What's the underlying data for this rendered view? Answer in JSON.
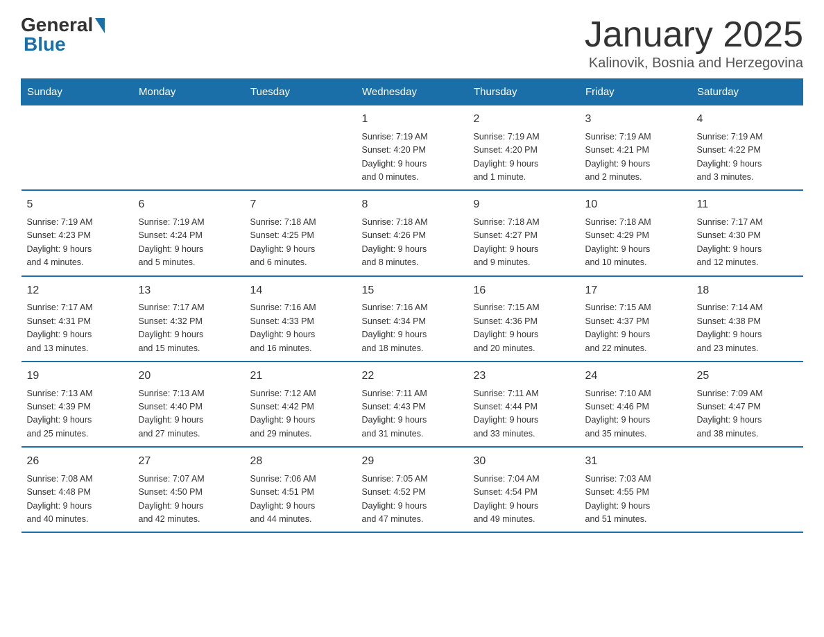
{
  "logo": {
    "general": "General",
    "blue": "Blue"
  },
  "header": {
    "month_title": "January 2025",
    "location": "Kalinovik, Bosnia and Herzegovina"
  },
  "days_of_week": [
    "Sunday",
    "Monday",
    "Tuesday",
    "Wednesday",
    "Thursday",
    "Friday",
    "Saturday"
  ],
  "weeks": [
    [
      {
        "day": "",
        "info": ""
      },
      {
        "day": "",
        "info": ""
      },
      {
        "day": "",
        "info": ""
      },
      {
        "day": "1",
        "info": "Sunrise: 7:19 AM\nSunset: 4:20 PM\nDaylight: 9 hours\nand 0 minutes."
      },
      {
        "day": "2",
        "info": "Sunrise: 7:19 AM\nSunset: 4:20 PM\nDaylight: 9 hours\nand 1 minute."
      },
      {
        "day": "3",
        "info": "Sunrise: 7:19 AM\nSunset: 4:21 PM\nDaylight: 9 hours\nand 2 minutes."
      },
      {
        "day": "4",
        "info": "Sunrise: 7:19 AM\nSunset: 4:22 PM\nDaylight: 9 hours\nand 3 minutes."
      }
    ],
    [
      {
        "day": "5",
        "info": "Sunrise: 7:19 AM\nSunset: 4:23 PM\nDaylight: 9 hours\nand 4 minutes."
      },
      {
        "day": "6",
        "info": "Sunrise: 7:19 AM\nSunset: 4:24 PM\nDaylight: 9 hours\nand 5 minutes."
      },
      {
        "day": "7",
        "info": "Sunrise: 7:18 AM\nSunset: 4:25 PM\nDaylight: 9 hours\nand 6 minutes."
      },
      {
        "day": "8",
        "info": "Sunrise: 7:18 AM\nSunset: 4:26 PM\nDaylight: 9 hours\nand 8 minutes."
      },
      {
        "day": "9",
        "info": "Sunrise: 7:18 AM\nSunset: 4:27 PM\nDaylight: 9 hours\nand 9 minutes."
      },
      {
        "day": "10",
        "info": "Sunrise: 7:18 AM\nSunset: 4:29 PM\nDaylight: 9 hours\nand 10 minutes."
      },
      {
        "day": "11",
        "info": "Sunrise: 7:17 AM\nSunset: 4:30 PM\nDaylight: 9 hours\nand 12 minutes."
      }
    ],
    [
      {
        "day": "12",
        "info": "Sunrise: 7:17 AM\nSunset: 4:31 PM\nDaylight: 9 hours\nand 13 minutes."
      },
      {
        "day": "13",
        "info": "Sunrise: 7:17 AM\nSunset: 4:32 PM\nDaylight: 9 hours\nand 15 minutes."
      },
      {
        "day": "14",
        "info": "Sunrise: 7:16 AM\nSunset: 4:33 PM\nDaylight: 9 hours\nand 16 minutes."
      },
      {
        "day": "15",
        "info": "Sunrise: 7:16 AM\nSunset: 4:34 PM\nDaylight: 9 hours\nand 18 minutes."
      },
      {
        "day": "16",
        "info": "Sunrise: 7:15 AM\nSunset: 4:36 PM\nDaylight: 9 hours\nand 20 minutes."
      },
      {
        "day": "17",
        "info": "Sunrise: 7:15 AM\nSunset: 4:37 PM\nDaylight: 9 hours\nand 22 minutes."
      },
      {
        "day": "18",
        "info": "Sunrise: 7:14 AM\nSunset: 4:38 PM\nDaylight: 9 hours\nand 23 minutes."
      }
    ],
    [
      {
        "day": "19",
        "info": "Sunrise: 7:13 AM\nSunset: 4:39 PM\nDaylight: 9 hours\nand 25 minutes."
      },
      {
        "day": "20",
        "info": "Sunrise: 7:13 AM\nSunset: 4:40 PM\nDaylight: 9 hours\nand 27 minutes."
      },
      {
        "day": "21",
        "info": "Sunrise: 7:12 AM\nSunset: 4:42 PM\nDaylight: 9 hours\nand 29 minutes."
      },
      {
        "day": "22",
        "info": "Sunrise: 7:11 AM\nSunset: 4:43 PM\nDaylight: 9 hours\nand 31 minutes."
      },
      {
        "day": "23",
        "info": "Sunrise: 7:11 AM\nSunset: 4:44 PM\nDaylight: 9 hours\nand 33 minutes."
      },
      {
        "day": "24",
        "info": "Sunrise: 7:10 AM\nSunset: 4:46 PM\nDaylight: 9 hours\nand 35 minutes."
      },
      {
        "day": "25",
        "info": "Sunrise: 7:09 AM\nSunset: 4:47 PM\nDaylight: 9 hours\nand 38 minutes."
      }
    ],
    [
      {
        "day": "26",
        "info": "Sunrise: 7:08 AM\nSunset: 4:48 PM\nDaylight: 9 hours\nand 40 minutes."
      },
      {
        "day": "27",
        "info": "Sunrise: 7:07 AM\nSunset: 4:50 PM\nDaylight: 9 hours\nand 42 minutes."
      },
      {
        "day": "28",
        "info": "Sunrise: 7:06 AM\nSunset: 4:51 PM\nDaylight: 9 hours\nand 44 minutes."
      },
      {
        "day": "29",
        "info": "Sunrise: 7:05 AM\nSunset: 4:52 PM\nDaylight: 9 hours\nand 47 minutes."
      },
      {
        "day": "30",
        "info": "Sunrise: 7:04 AM\nSunset: 4:54 PM\nDaylight: 9 hours\nand 49 minutes."
      },
      {
        "day": "31",
        "info": "Sunrise: 7:03 AM\nSunset: 4:55 PM\nDaylight: 9 hours\nand 51 minutes."
      },
      {
        "day": "",
        "info": ""
      }
    ]
  ]
}
